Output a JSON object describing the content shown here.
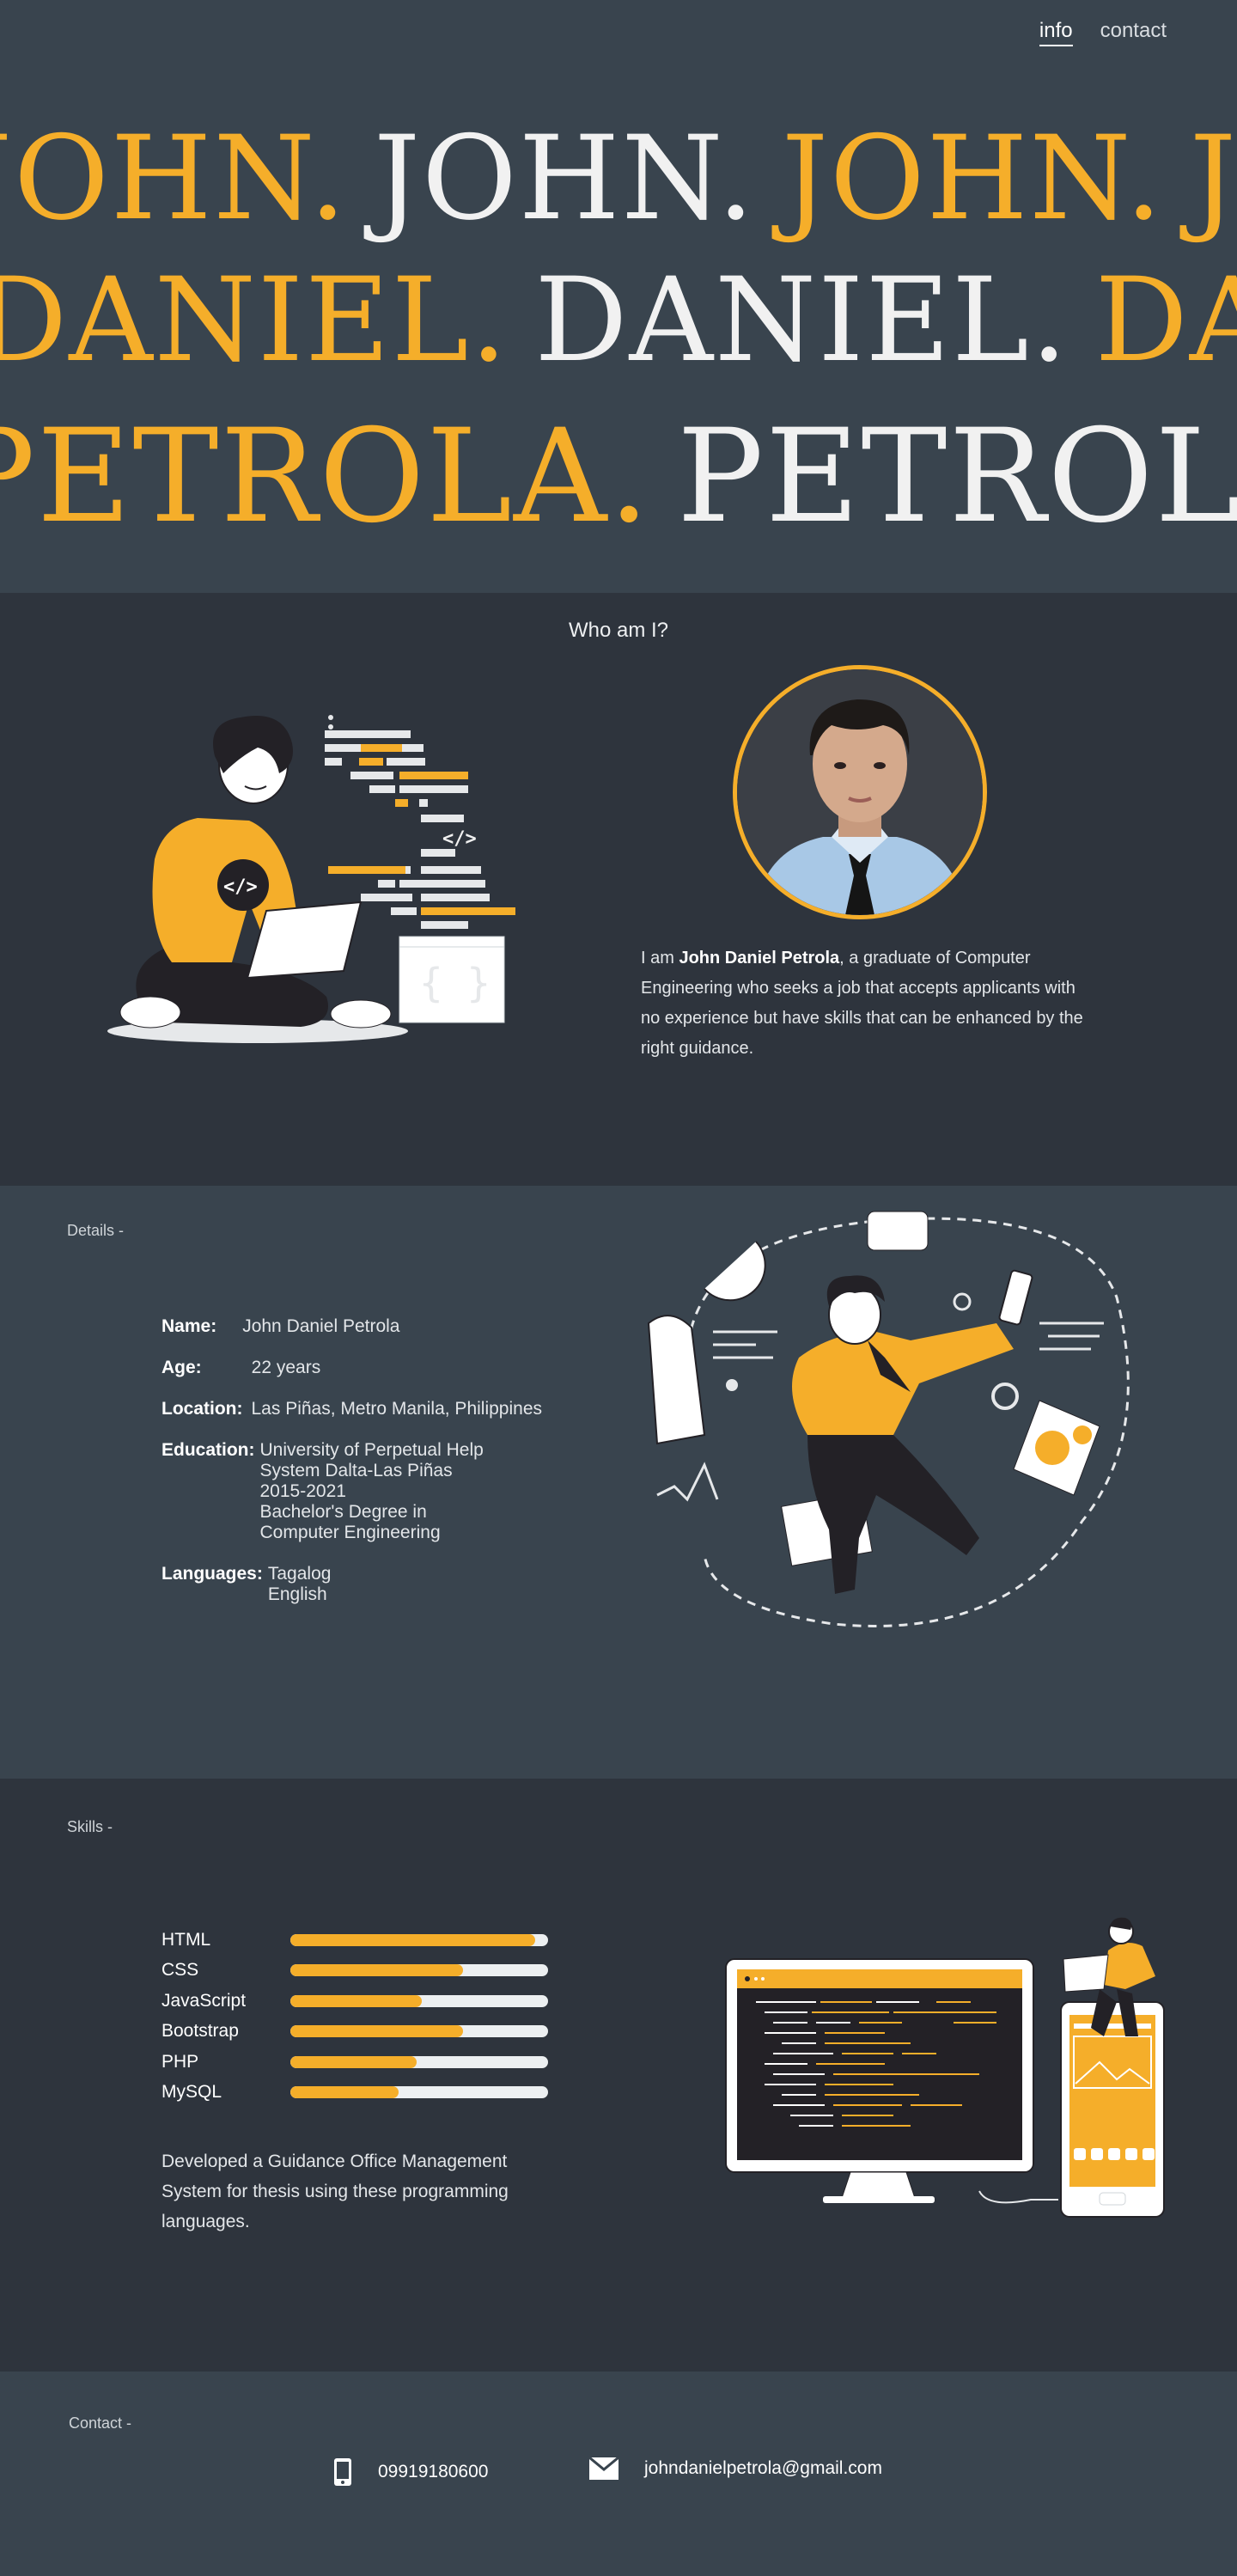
{
  "nav": {
    "info": "info",
    "contact": "contact"
  },
  "hero": {
    "first": "JOHN.",
    "middle": "DANIEL.",
    "last": "PETROLA."
  },
  "who": {
    "title": "Who am I?",
    "about_prefix": "I am ",
    "about_name": "John Daniel Petrola",
    "about_suffix": ", a graduate of Computer Engineering who seeks a job that accepts applicants with no experience but have skills that can be enhanced by the right guidance.",
    "code_glyph": "</>",
    "braces_glyph": "{ }"
  },
  "details": {
    "title": "Details -",
    "name_label": "Name:",
    "name_value": "John Daniel Petrola",
    "age_label": "Age:",
    "age_value": "22 years",
    "location_label": "Location:",
    "location_value": "Las Piñas, Metro Manila, Philippines",
    "education_label": "Education:",
    "education_lines": [
      "University of Perpetual Help",
      "System Dalta-Las Piñas",
      "2015-2021",
      "Bachelor's Degree in",
      "Computer Engineering"
    ],
    "languages_label": "Languages:",
    "languages": [
      "Tagalog",
      "English"
    ]
  },
  "skills": {
    "title": "Skills -",
    "items": [
      {
        "label": "HTML",
        "level": 0.95
      },
      {
        "label": "CSS",
        "level": 0.67
      },
      {
        "label": "JavaScript",
        "level": 0.51
      },
      {
        "label": "Bootstrap",
        "level": 0.67
      },
      {
        "label": "PHP",
        "level": 0.49
      },
      {
        "label": "MySQL",
        "level": 0.42
      }
    ],
    "note": "Developed a Guidance Office Management System for thesis using these programming languages."
  },
  "contact": {
    "title": "Contact -",
    "phone": "09919180600",
    "email": "johndanielpetrola@gmail.com",
    "phone_icon": "phone-icon",
    "email_icon": "mail-icon"
  },
  "colors": {
    "accent": "#f5ae2a",
    "dark": "#2e343d",
    "slate": "#39444e"
  }
}
